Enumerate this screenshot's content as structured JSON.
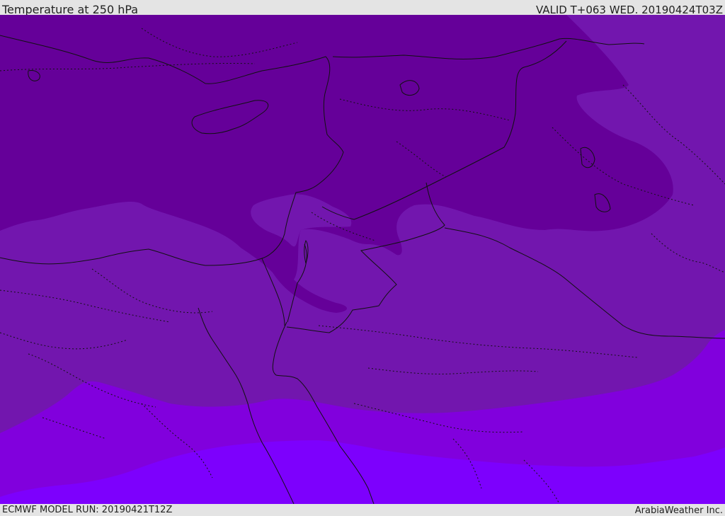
{
  "header": {
    "title": "Temperature at 250 hPa",
    "valid": "VALID T+063 WED. 20190424T03Z"
  },
  "footer": {
    "model_run": "ECMWF MODEL RUN: 20190421T12Z",
    "credit": "ArabiaWeather Inc."
  },
  "map": {
    "region": "Eastern Mediterranean and Middle East",
    "colors": {
      "band_coldest": "#650099",
      "band_cold": "#7216ae",
      "band_mid": "#8100dd",
      "band_warm": "#7d00fd",
      "coastline": "#111111",
      "border": "#111111"
    }
  }
}
